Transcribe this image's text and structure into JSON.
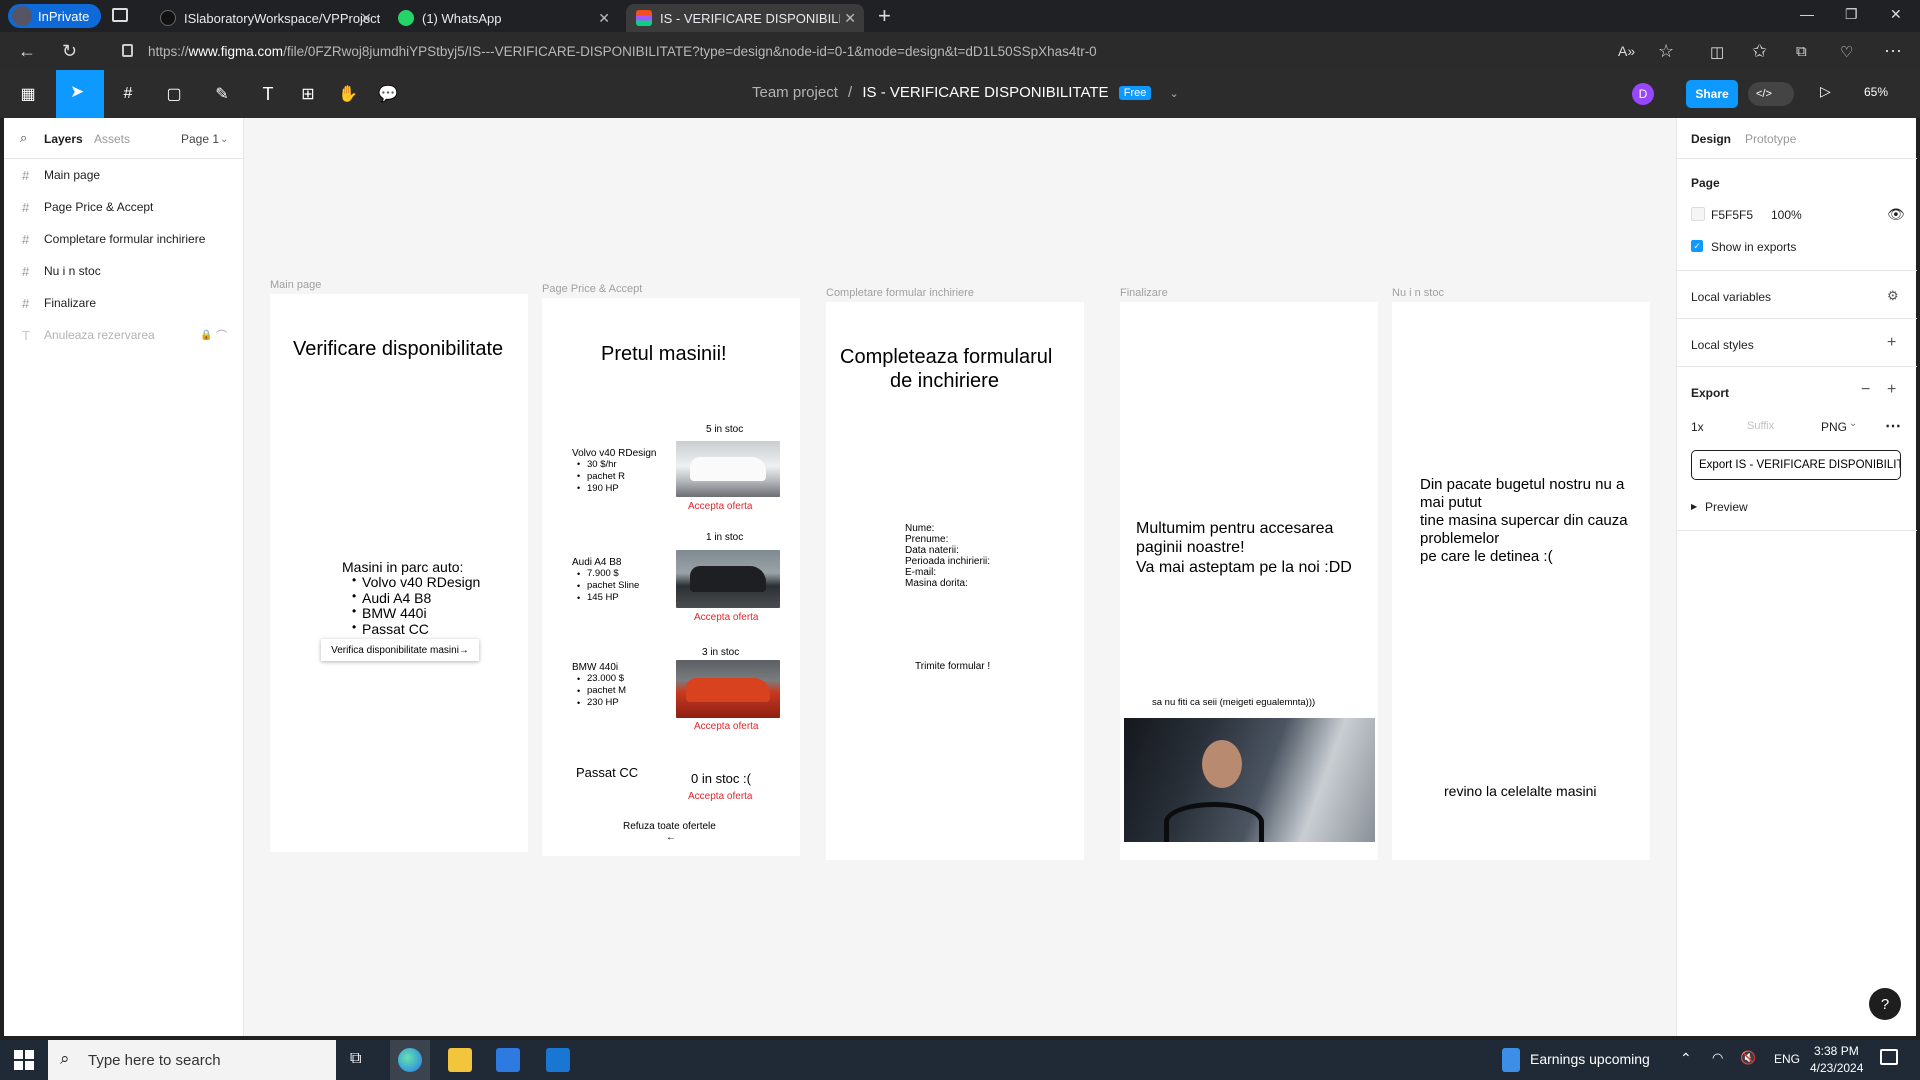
{
  "browser": {
    "inprivate_label": "InPrivate",
    "tabs": [
      {
        "title": "ISlaboratoryWorkspace/VPProject",
        "icon": "github-icon"
      },
      {
        "title": "(1) WhatsApp",
        "icon": "whatsapp-icon"
      },
      {
        "title": "IS - VERIFICARE DISPONIBILITATE",
        "icon": "figma-icon"
      }
    ],
    "url_prefix": "https://",
    "url_domain": "www.figma.com",
    "url_rest": "/file/0FZRwoj8jumdhiYPStbyj5/IS---VERIFICARE-DISPONIBILITATE?type=design&node-id=0-1&mode=design&t=dD1L50SSpXhas4tr-0"
  },
  "toolbar": {
    "project": "Team project",
    "separator": "/",
    "file_name": "IS - VERIFICARE DISPONIBILITATE",
    "badge": "Free",
    "avatar_letter": "D",
    "share_label": "Share",
    "zoom": "65%"
  },
  "left_panel": {
    "tabs": {
      "layers": "Layers",
      "assets": "Assets",
      "page": "Page 1"
    },
    "layers": [
      {
        "label": "Main page",
        "type": "frame"
      },
      {
        "label": "Page Price & Accept",
        "type": "frame"
      },
      {
        "label": "Completare formular inchiriere",
        "type": "frame"
      },
      {
        "label": "Nu i n stoc",
        "type": "frame"
      },
      {
        "label": "Finalizare",
        "type": "frame"
      },
      {
        "label": "Anuleaza rezervarea",
        "type": "text",
        "hidden": true
      }
    ]
  },
  "canvas": {
    "frames": {
      "main": {
        "label": "Main page",
        "title": "Verificare disponibilitate",
        "list_title": "Masini in parc auto:",
        "list": [
          "Volvo v40 RDesign",
          "Audi A4 B8",
          "BMW 440i",
          "Passat CC"
        ],
        "button": "Verifica disponibilitate masini→"
      },
      "price": {
        "label": "Page Price & Accept",
        "title": "Pretul masinii!",
        "cars": [
          {
            "name": "Volvo v40 RDesign",
            "specs": [
              "30 $/hr",
              "pachet R",
              "190 HP"
            ],
            "stock": "5 in stoc",
            "accept": "Accepta oferta"
          },
          {
            "name": "Audi A4  B8",
            "specs": [
              "7.900 $",
              "pachet Sline",
              "145 HP"
            ],
            "stock": "1 in stoc",
            "accept": "Accepta oferta"
          },
          {
            "name": "BMW 440i",
            "specs": [
              "23.000 $",
              "pachet M",
              "230 HP"
            ],
            "stock": "3 in stoc",
            "accept": "Accepta oferta"
          }
        ],
        "passat_name": "Passat CC",
        "passat_stock": "0 in stoc :(",
        "passat_accept": "Accepta oferta",
        "refuse": "Refuza toate ofertele",
        "refuse_arrow": "←"
      },
      "form": {
        "label": "Completare formular inchiriere",
        "title_line1": "Completeaza formularul",
        "title_line2": "de inchiriere",
        "fields": [
          "Nume:",
          "Prenume:",
          "Data naterii:",
          "Perioada inchirierii:",
          "E-mail:",
          "Masina dorita:"
        ],
        "submit": "Trimite formular !"
      },
      "final": {
        "label": "Finalizare",
        "line1": "Multumim pentru accesarea",
        "line2": "paginii noastre!",
        "line3": "Va mai asteptam pe la noi :DD",
        "caption": "sa nu fiti ca seii (meigeti egualemnta)))"
      },
      "nostock": {
        "label": "Nu i n stoc",
        "lines": [
          "Din pacate bugetul nostru nu a",
          "mai putut",
          "tine masina supercar din cauza",
          "problemelor",
          "pe care le detinea :("
        ],
        "back": "revino la celelalte masini"
      }
    }
  },
  "right_panel": {
    "tabs": {
      "design": "Design",
      "prototype": "Prototype"
    },
    "page_title": "Page",
    "bg_color": "F5F5F5",
    "bg_opacity": "100%",
    "show_in_exports": "Show in exports",
    "local_variables": "Local variables",
    "local_styles": "Local styles",
    "export_title": "Export",
    "export_scale": "1x",
    "export_suffix_placeholder": "Suffix",
    "export_format": "PNG",
    "export_button": "Export IS - VERIFICARE DISPONIBILIT...",
    "preview": "Preview"
  },
  "taskbar": {
    "search_placeholder": "Type here to search",
    "news": "Earnings upcoming",
    "lang": "ENG",
    "time": "3:38 PM",
    "date": "4/23/2024"
  },
  "colors": {
    "accent": "#0d99ff",
    "canvas_bg": "#F5F5F5",
    "accept_red": "#e0262b",
    "toolbar": "#2c2c2c"
  }
}
